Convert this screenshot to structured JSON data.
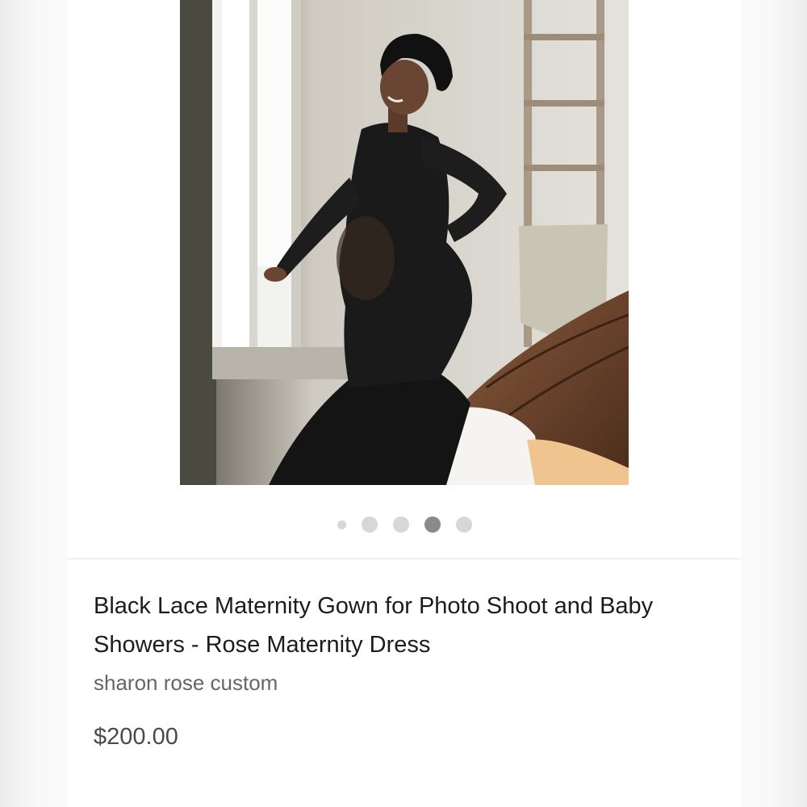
{
  "carousel": {
    "image_alt": "Woman in black lace maternity gown posing by a window",
    "dot_count": 5,
    "active_index": 3
  },
  "product": {
    "title": "Black Lace Maternity Gown for Photo Shoot and Baby Showers - Rose Maternity Dress",
    "seller": "sharon rose custom",
    "price": "$200.00"
  },
  "colors": {
    "dot_inactive": "#d7d7d7",
    "dot_active": "#8a8a8a",
    "title_text": "#1c1c1c",
    "seller_text": "#666666",
    "price_text": "#4a4a4a"
  }
}
